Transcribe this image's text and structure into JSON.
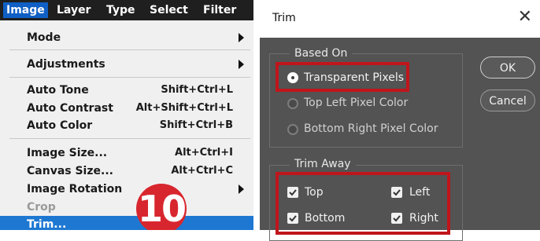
{
  "menubar": {
    "items": [
      "Image",
      "Layer",
      "Type",
      "Select",
      "Filter"
    ]
  },
  "menu": {
    "mode": "Mode",
    "adjustments": "Adjustments",
    "auto_tone": {
      "label": "Auto Tone",
      "shortcut": "Shift+Ctrl+L"
    },
    "auto_contrast": {
      "label": "Auto Contrast",
      "shortcut": "Alt+Shift+Ctrl+L"
    },
    "auto_color": {
      "label": "Auto Color",
      "shortcut": "Shift+Ctrl+B"
    },
    "image_size": {
      "label": "Image Size...",
      "shortcut": "Alt+Ctrl+I"
    },
    "canvas_size": {
      "label": "Canvas Size...",
      "shortcut": "Alt+Ctrl+C"
    },
    "image_rotation": "Image Rotation",
    "crop": "Crop",
    "trim": "Trim..."
  },
  "step_badge": "10",
  "dialog": {
    "title": "Trim",
    "close_glyph": "✕",
    "based_on": {
      "title": "Based On",
      "options": [
        "Transparent Pixels",
        "Top Left Pixel Color",
        "Bottom Right Pixel Color"
      ],
      "selected": "Transparent Pixels"
    },
    "trim_away": {
      "title": "Trim Away",
      "top": "Top",
      "left": "Left",
      "bottom": "Bottom",
      "right": "Right",
      "checked": [
        "Top",
        "Left",
        "Bottom",
        "Right"
      ]
    },
    "ok_label": "OK",
    "cancel_label": "Cancel"
  },
  "colors": {
    "highlight": "#c0151c",
    "badge": "#d8262e",
    "menu_selection": "#1e78d2",
    "dialog_bg": "#535353"
  }
}
